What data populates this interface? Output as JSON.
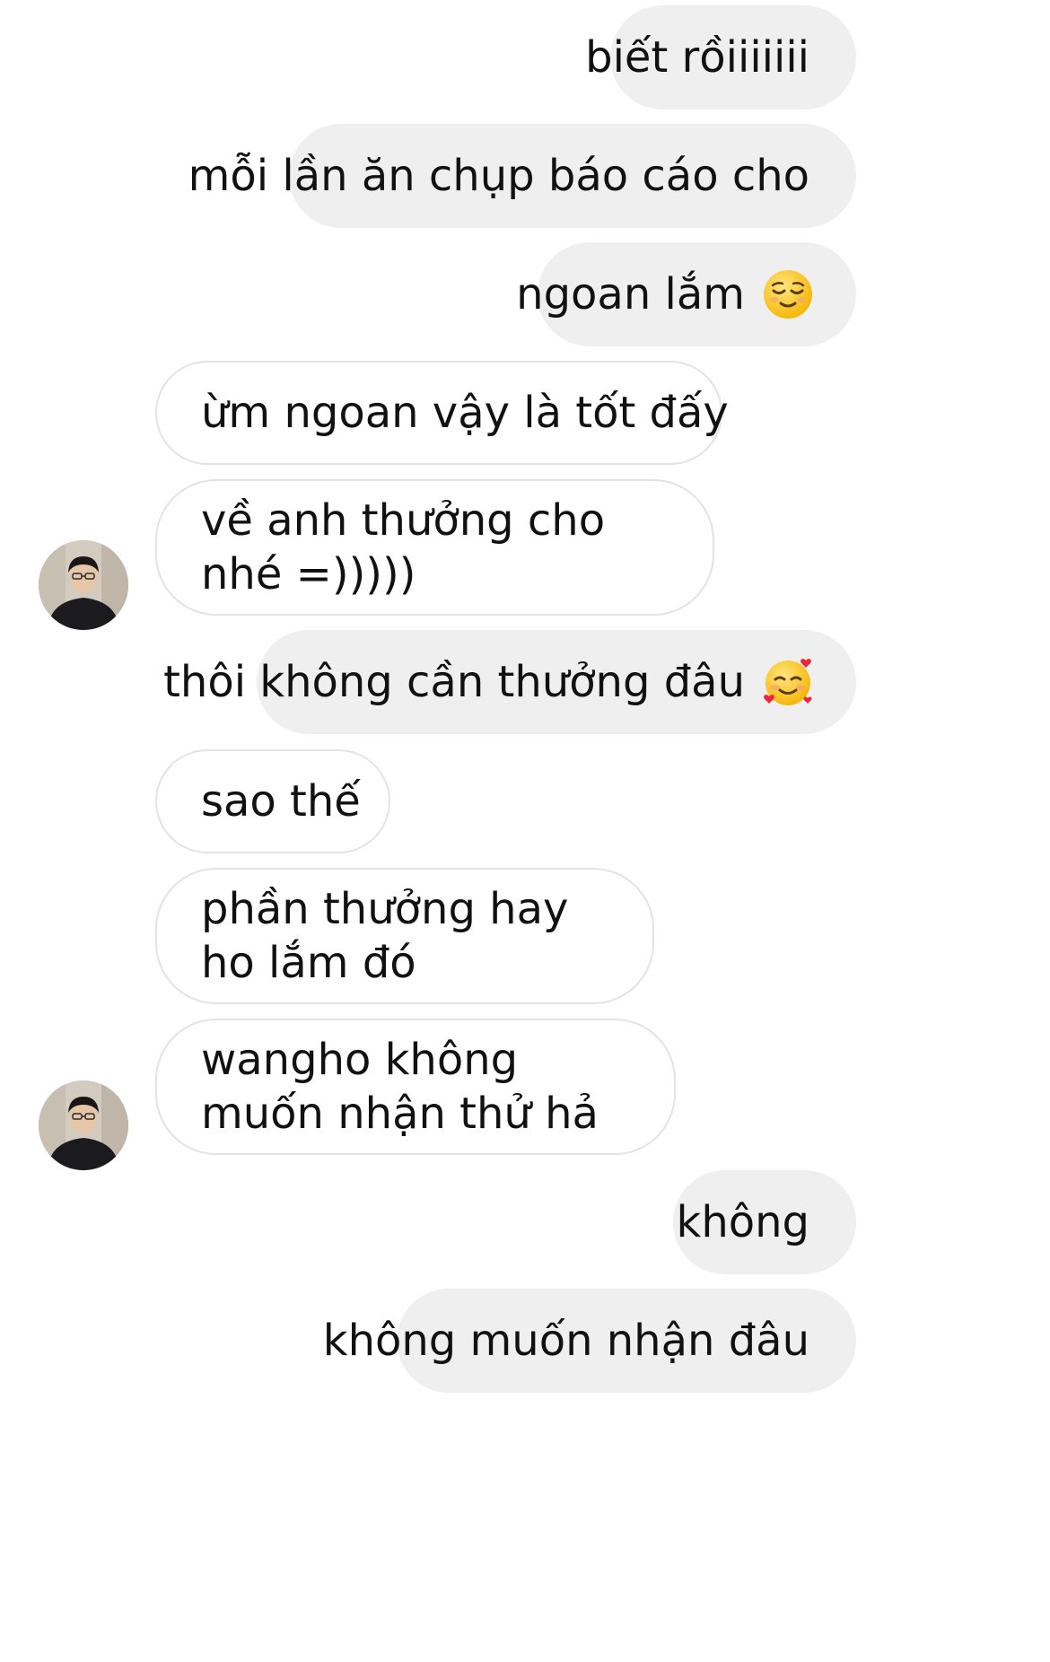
{
  "messages": [
    {
      "id": "m1",
      "side": "out",
      "text": "biết rồiiiiiii",
      "emoji": ""
    },
    {
      "id": "m2",
      "side": "out",
      "text": "mỗi lần ăn chụp báo cáo cho",
      "emoji": ""
    },
    {
      "id": "m3",
      "side": "out",
      "text": "ngoan lắm",
      "emoji": "relieved-face"
    },
    {
      "id": "m4",
      "side": "in",
      "text": "ừm ngoan vậy là tốt đấy"
    },
    {
      "id": "m5",
      "side": "in",
      "text": "về anh thưởng cho nhé =)))))"
    },
    {
      "id": "m6",
      "side": "out",
      "text": "thôi không cần thưởng đâu",
      "emoji": "smiling-face-with-hearts"
    },
    {
      "id": "m7",
      "side": "in",
      "text": "sao thế"
    },
    {
      "id": "m8",
      "side": "in",
      "text": "phần thưởng hay ho lắm đó"
    },
    {
      "id": "m9",
      "side": "in",
      "text": "wangho không muốn nhận thử hả"
    },
    {
      "id": "m10",
      "side": "out",
      "text": "không",
      "emoji": ""
    },
    {
      "id": "m11",
      "side": "out",
      "text": "không muốn nhận đâu",
      "emoji": ""
    }
  ],
  "colors": {
    "outgoing_bubble": "#efefef",
    "incoming_border": "#e3e3e3",
    "text": "#111111"
  }
}
